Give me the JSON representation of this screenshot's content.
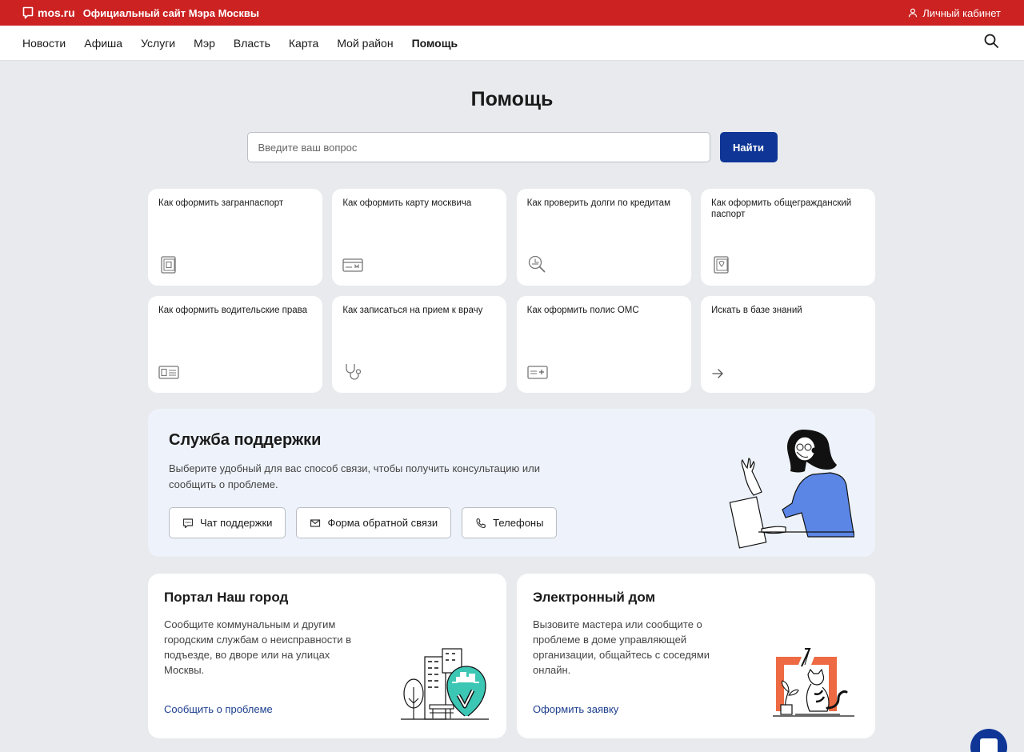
{
  "topbar": {
    "logo": "mos.ru",
    "site_title": "Официальный сайт Мэра Москвы",
    "cabinet": "Личный кабинет"
  },
  "nav": {
    "items": [
      "Новости",
      "Афиша",
      "Услуги",
      "Мэр",
      "Власть",
      "Карта",
      "Мой район",
      "Помощь"
    ],
    "active": "Помощь"
  },
  "page": {
    "title": "Помощь"
  },
  "search": {
    "placeholder": "Введите ваш вопрос",
    "button": "Найти"
  },
  "cards": [
    {
      "title": "Как оформить загранпаспорт",
      "icon": "passport-icon"
    },
    {
      "title": "Как оформить карту москвича",
      "icon": "card-icon"
    },
    {
      "title": "Как проверить долги по кредитам",
      "icon": "magnifier-chart-icon"
    },
    {
      "title": "Как оформить общегражданский паспорт",
      "icon": "passport-emblem-icon"
    },
    {
      "title": "Как оформить водительские права",
      "icon": "license-icon"
    },
    {
      "title": "Как записаться на прием к врачу",
      "icon": "stethoscope-icon"
    },
    {
      "title": "Как оформить полис ОМС",
      "icon": "medical-card-icon"
    },
    {
      "title": "Искать в базе знаний",
      "icon": "arrow-right-icon"
    }
  ],
  "support": {
    "title": "Служба поддержки",
    "description": "Выберите удобный для вас способ связи, чтобы получить консультацию или сообщить о проблеме.",
    "buttons": [
      {
        "label": "Чат поддержки",
        "icon": "chat-icon"
      },
      {
        "label": "Форма обратной связи",
        "icon": "mail-icon"
      },
      {
        "label": "Телефоны",
        "icon": "phone-icon"
      }
    ]
  },
  "portal": {
    "title": "Портал Наш город",
    "description": "Сообщите коммунальным и другим городским службам о неисправности в подъезде, во дворе или на улицах Москвы.",
    "link": "Сообщить о проблеме"
  },
  "edom": {
    "title": "Электронный дом",
    "description": "Вызовите мастера или сообщите о проблеме в доме управляющей организации, общайтесь с соседями онлайн.",
    "link": "Оформить заявку"
  },
  "colors": {
    "brand_red": "#cc2222",
    "primary_blue": "#0f3696",
    "link_blue": "#1d3f8e",
    "accent_teal": "#3cc6b4",
    "accent_orange": "#ee6a42",
    "support_bg": "#eef3fb"
  }
}
